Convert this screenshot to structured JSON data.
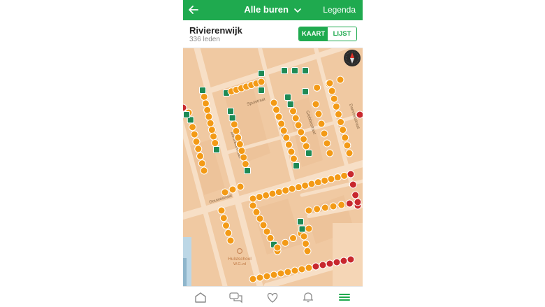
{
  "topbar": {
    "title": "Alle buren",
    "legend_label": "Legenda"
  },
  "header": {
    "neighbourhood": "Rivierenwijk",
    "members": "336 leden"
  },
  "view_toggle": {
    "map_label": "KAART",
    "list_label": "LIJST"
  },
  "map": {
    "streets": [
      "Spuistraat",
      "Merwedestraat",
      "Dintelstraat",
      "Gouwestraat",
      "Grebbestraat",
      "Dommelstraat"
    ],
    "poi": {
      "name": "Hulstschool",
      "subtitle": "W.G.vd"
    }
  },
  "colors": {
    "brand": "#1faa4f",
    "marker_orange": "#f39a16",
    "marker_green": "#1e8a55",
    "marker_red": "#c8282e",
    "map_land": "#f0c9a2",
    "map_road": "#f7dfc6"
  },
  "tabbar": {
    "items": [
      {
        "icon": "home-icon"
      },
      {
        "icon": "chat-icon"
      },
      {
        "icon": "heart-icon"
      },
      {
        "icon": "bell-icon"
      },
      {
        "icon": "menu-icon"
      }
    ]
  }
}
